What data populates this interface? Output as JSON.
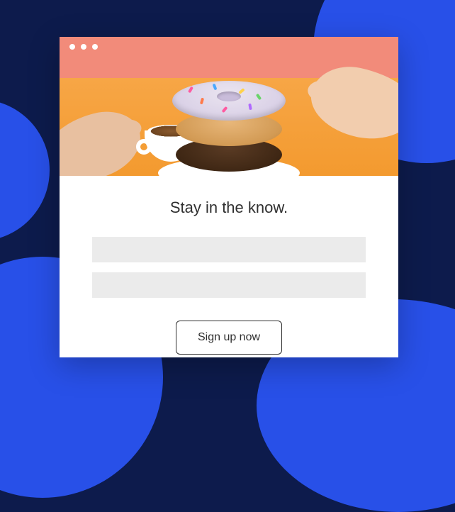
{
  "headline": "Stay in the know.",
  "form": {
    "field1_placeholder": "",
    "field1_value": "",
    "field2_placeholder": "",
    "field2_value": "",
    "submit_label": "Sign up now"
  },
  "colors": {
    "page_bg": "#0d1b4c",
    "accent_blob": "#2850e8",
    "titlebar": "#f28b7a",
    "hero_bg": "#f39a2f",
    "field_bg": "#ebebeb",
    "text": "#303030"
  },
  "hero": {
    "description": "coffee-and-donuts-photo"
  }
}
